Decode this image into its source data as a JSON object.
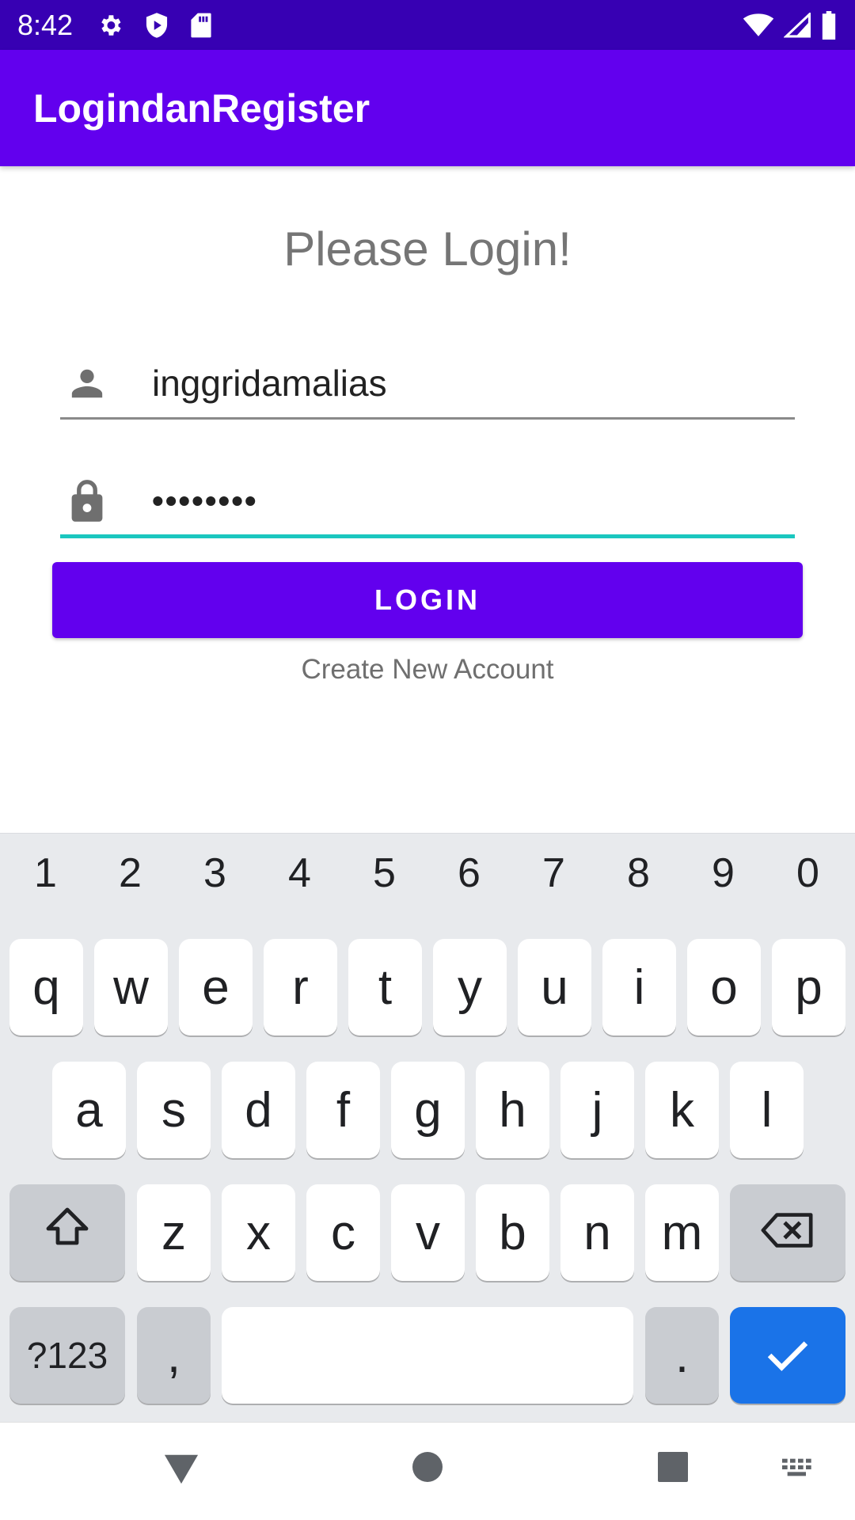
{
  "status_bar": {
    "time": "8:42",
    "left_icons": [
      "gear-icon",
      "shield-play-icon",
      "sd-card-icon"
    ],
    "right_icons": [
      "wifi-icon",
      "cell-signal-icon",
      "battery-icon"
    ]
  },
  "app_bar": {
    "title": "LogindanRegister"
  },
  "login": {
    "heading": "Please Login!",
    "username_value": "inggridamalias",
    "username_icon": "person-icon",
    "password_value": "••••••••",
    "password_icon": "lock-icon",
    "login_button_label": "LOGIN",
    "create_account_label": "Create New Account"
  },
  "keyboard": {
    "number_row": [
      "1",
      "2",
      "3",
      "4",
      "5",
      "6",
      "7",
      "8",
      "9",
      "0"
    ],
    "row1": [
      "q",
      "w",
      "e",
      "r",
      "t",
      "y",
      "u",
      "i",
      "o",
      "p"
    ],
    "row2": [
      "a",
      "s",
      "d",
      "f",
      "g",
      "h",
      "j",
      "k",
      "l"
    ],
    "row3": [
      "z",
      "x",
      "c",
      "v",
      "b",
      "n",
      "m"
    ],
    "symbols_label": "?123",
    "comma_label": ",",
    "period_label": ".",
    "shift_icon": "shift-icon",
    "backspace_icon": "backspace-icon",
    "enter_icon": "checkmark-icon"
  },
  "nav_bar": {
    "icons": [
      "back-icon",
      "home-icon",
      "recents-icon",
      "keyboard-switch-icon"
    ]
  },
  "colors": {
    "status_bar": "#3700b3",
    "primary": "#6200ee",
    "accent_underline": "#1ac7bf",
    "keyboard_bg": "#e8eaed",
    "enter_key": "#1a73e8"
  }
}
